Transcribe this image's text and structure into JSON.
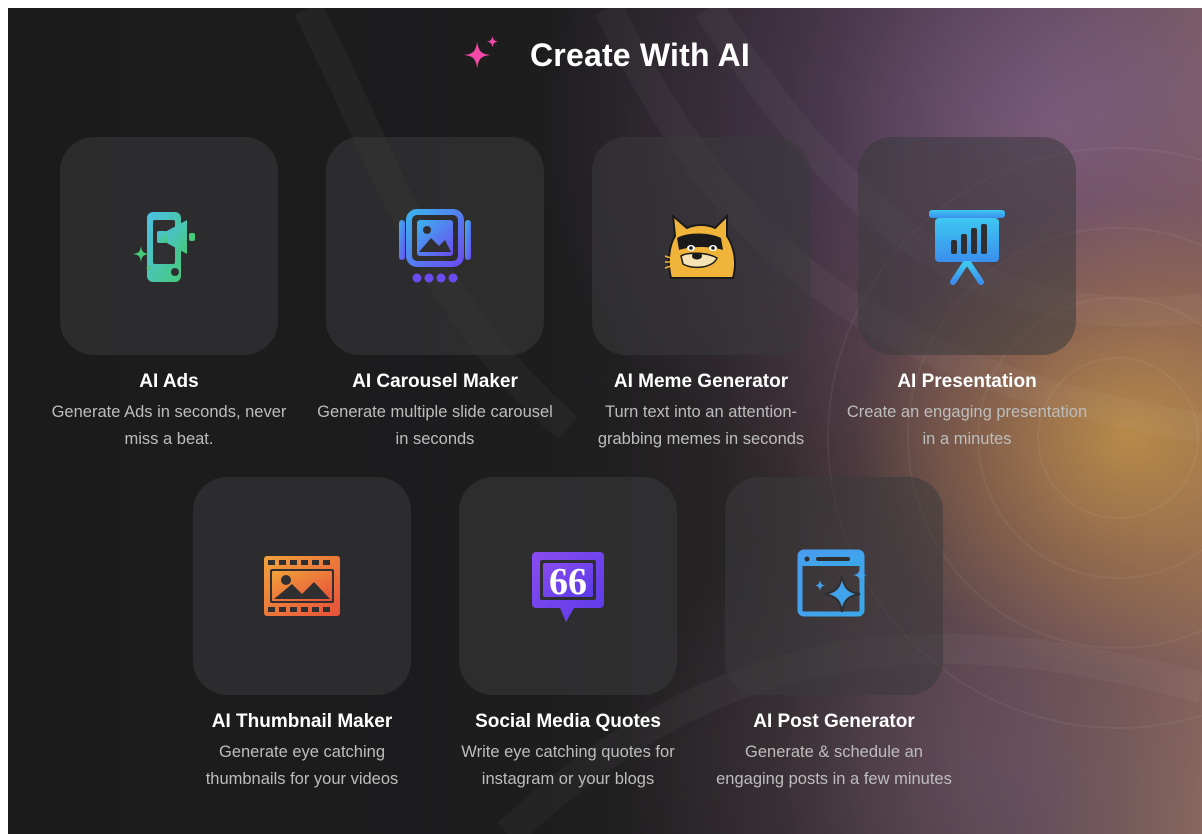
{
  "header": {
    "icon": "sparkle-icon",
    "title": "Create With AI"
  },
  "colors": {
    "sparkle": "#f24aa6",
    "background": "#1c1c1d",
    "tile": "#2f2f31",
    "title_text": "#ffffff",
    "desc_text": "#bdbdbd"
  },
  "tools": [
    {
      "icon": "ad-megaphone-icon",
      "name": "AI Ads",
      "description": "Generate Ads in seconds, never miss a beat."
    },
    {
      "icon": "carousel-icon",
      "name": "AI Carousel Maker",
      "description": "Generate multiple slide carousel in seconds"
    },
    {
      "icon": "doge-meme-icon",
      "name": "AI Meme Generator",
      "description": "Turn text into an attention-grabbing memes in seconds"
    },
    {
      "icon": "presentation-board-icon",
      "name": "AI Presentation",
      "description": "Create an engaging presentation in a minutes"
    },
    {
      "icon": "thumbnail-film-icon",
      "name": "AI Thumbnail Maker",
      "description": "Generate eye catching thumbnails for your videos"
    },
    {
      "icon": "quote-bubble-icon",
      "name": "Social Media Quotes",
      "description": "Write eye catching quotes for instagram or your blogs"
    },
    {
      "icon": "post-sparkle-icon",
      "name": "AI Post Generator",
      "description": "Generate & schedule an engaging posts in a few minutes"
    }
  ]
}
